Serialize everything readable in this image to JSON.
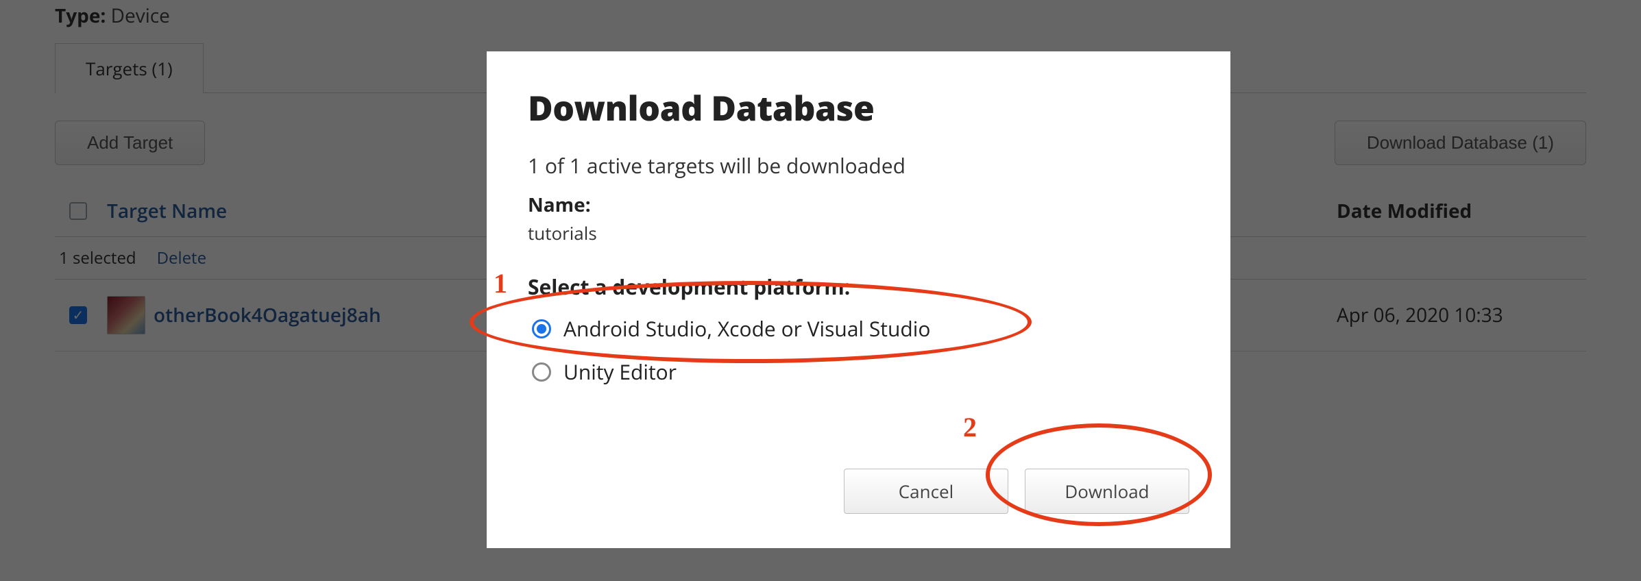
{
  "type": {
    "label": "Type:",
    "value": "Device"
  },
  "tabs": {
    "targets": "Targets (1)"
  },
  "toolbar": {
    "add_target": "Add Target",
    "download_db": "Download Database (1)"
  },
  "columns": {
    "name": "Target Name",
    "date": "Date Modified"
  },
  "selection": {
    "count": "1 selected",
    "delete": "Delete"
  },
  "rows": [
    {
      "name": "otherBook4Oagatuej8ah",
      "date": "Apr 06, 2020 10:33",
      "checked": true
    }
  ],
  "modal": {
    "title": "Download Database",
    "sub": "1 of 1 active targets will be downloaded",
    "name_label": "Name:",
    "name_value": "tutorials",
    "platform_label": "Select a development platform:",
    "options": {
      "native": "Android Studio, Xcode or Visual Studio",
      "unity": "Unity Editor"
    },
    "cancel": "Cancel",
    "download": "Download"
  },
  "annotations": {
    "one": "1",
    "two": "2"
  }
}
